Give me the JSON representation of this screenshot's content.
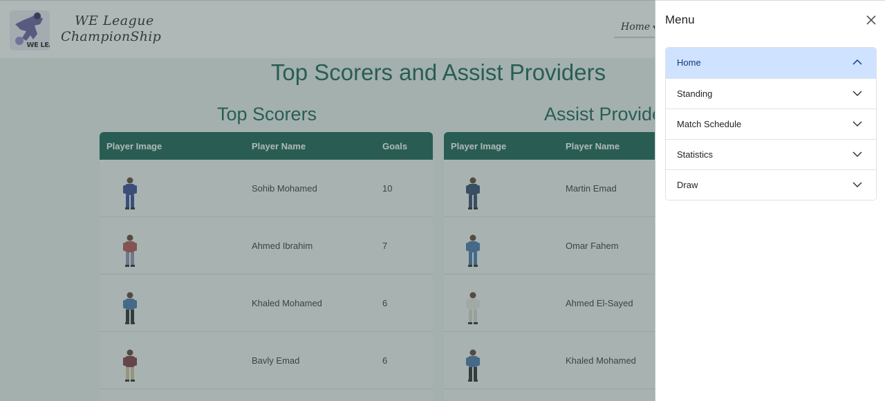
{
  "brand": {
    "line1": "WE League",
    "line2": "ChampionShip",
    "logo_text": "WE LEAGUE"
  },
  "nav": {
    "home_label": "Home"
  },
  "page": {
    "title": "Top Scorers and Assist Providers",
    "scorers_title": "Top Scorers",
    "assists_title": "Assist Provide"
  },
  "scorers": {
    "headers": [
      "Player Image",
      "Player Name",
      "Goals"
    ],
    "rows": [
      {
        "name": "Sohib Mohamed",
        "goals": "10",
        "shirt": "#2d3f8f",
        "pants": "#2d3f8f"
      },
      {
        "name": "Ahmed Ibrahim",
        "goals": "7",
        "shirt": "#b04a4a",
        "pants": "#8b8bb0"
      },
      {
        "name": "Khaled Mohamed",
        "goals": "6",
        "shirt": "#3f6fa8",
        "pants": "#1f1f1f"
      },
      {
        "name": "Bavly Emad",
        "goals": "6",
        "shirt": "#7a2f3a",
        "pants": "#cfc09a"
      }
    ]
  },
  "assists": {
    "headers": [
      "Player Image",
      "Player Name"
    ],
    "rows": [
      {
        "name": "Martin Emad",
        "shirt": "#2a3e66",
        "pants": "#2a3e66"
      },
      {
        "name": "Omar Fahem",
        "shirt": "#3f6fa8",
        "pants": "#3f6fa8"
      },
      {
        "name": "Ahmed El-Sayed",
        "shirt": "#e8e4dc",
        "pants": "#d8d2c8"
      },
      {
        "name": "Khaled Mohamed",
        "shirt": "#3f6fa8",
        "pants": "#1f1f1f"
      }
    ]
  },
  "menu": {
    "title": "Menu",
    "items": [
      {
        "label": "Home",
        "expanded": true
      },
      {
        "label": "Standing",
        "expanded": false
      },
      {
        "label": "Match Schedule",
        "expanded": false
      },
      {
        "label": "Statistics",
        "expanded": false
      },
      {
        "label": "Draw",
        "expanded": false
      }
    ]
  },
  "colors": {
    "primary": "#0c5a4a",
    "active_menu": "#cfe2ff",
    "overlay": "#4e615f"
  }
}
